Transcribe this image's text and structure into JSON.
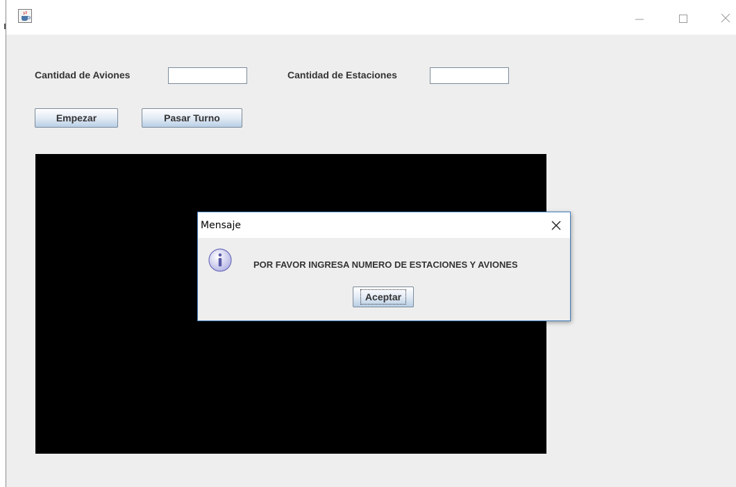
{
  "window": {
    "icon": "java-cup-icon",
    "controls": [
      "minimize-icon",
      "maximize-icon",
      "close-icon"
    ]
  },
  "form": {
    "aviones_label": "Cantidad de Aviones",
    "aviones_value": "",
    "estaciones_label": "Cantidad de Estaciones",
    "estaciones_value": "",
    "start_button": "Empezar",
    "next_turn_button": "Pasar Turno"
  },
  "dialog": {
    "title": "Mensaje",
    "icon": "information-icon",
    "message": "POR FAVOR INGRESA NUMERO DE ESTACIONES Y AVIONES",
    "ok_button": "Aceptar"
  },
  "colors": {
    "canvas": "#000000",
    "panel": "#eeeeee",
    "dialog_border": "#3d7ab8"
  }
}
